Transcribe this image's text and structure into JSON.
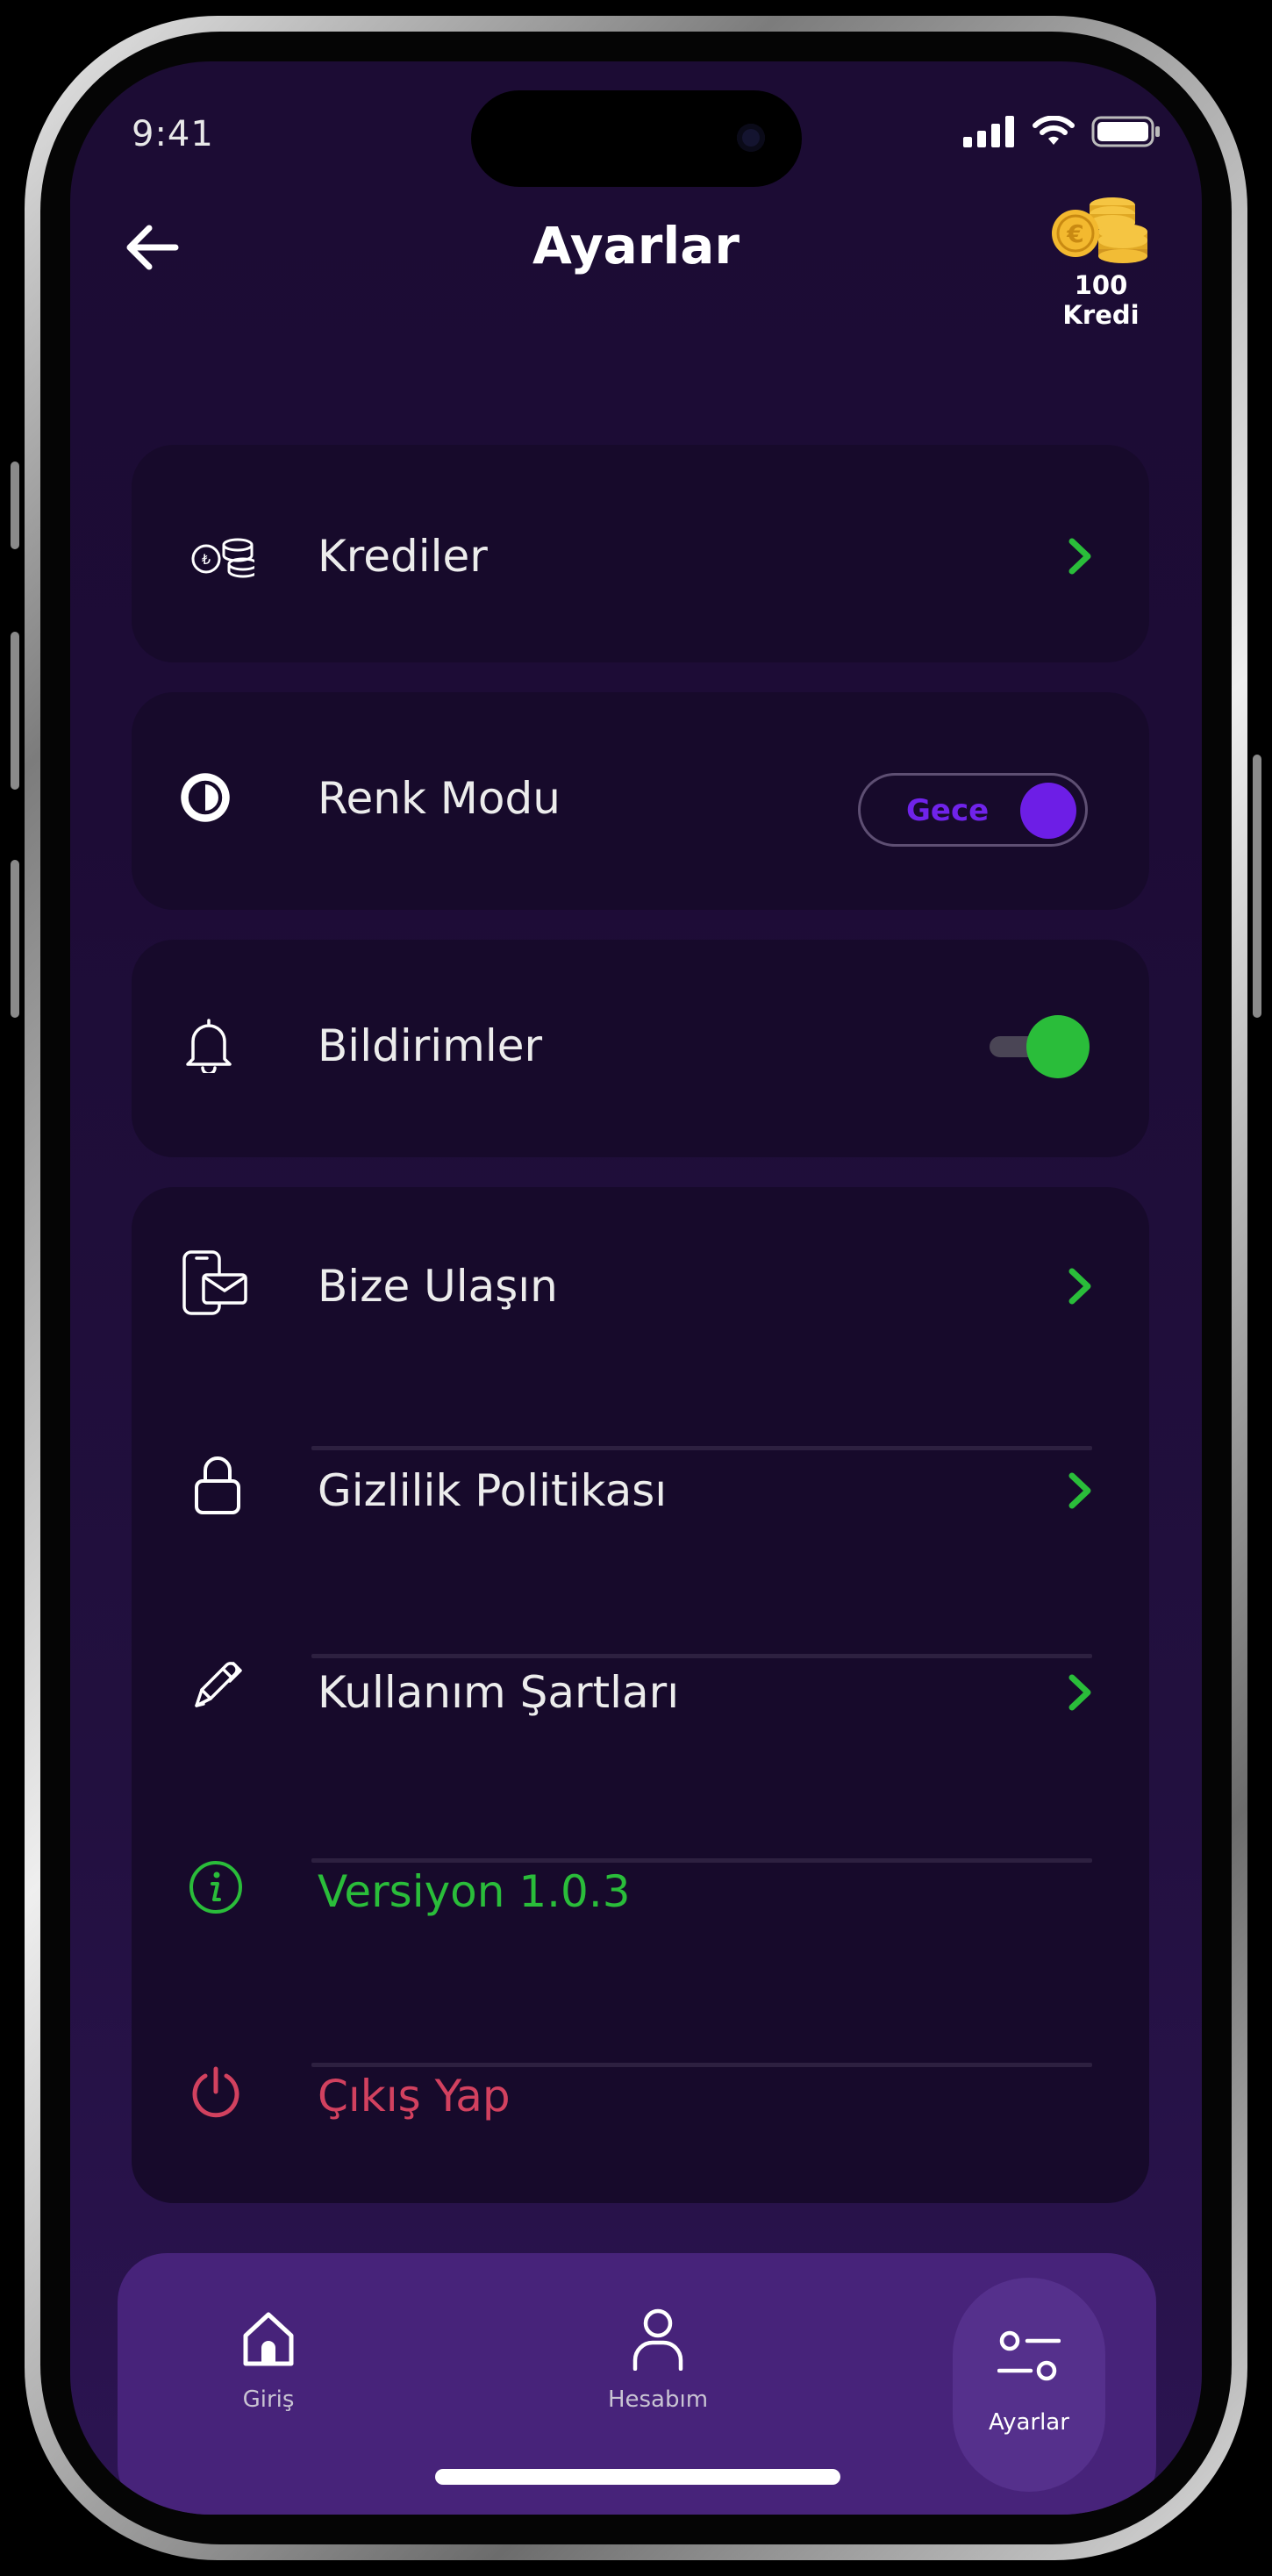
{
  "status_bar": {
    "time": "9:41"
  },
  "header": {
    "title": "Ayarlar",
    "credits_label": "100 Kredi"
  },
  "settings": {
    "credits": {
      "label": "Krediler"
    },
    "color_mode": {
      "label": "Renk Modu",
      "value": "Gece"
    },
    "notifications": {
      "label": "Bildirimler",
      "enabled": true
    },
    "links": [
      {
        "label": "Bize Ulaşın"
      },
      {
        "label": "Gizlilik Politikası"
      },
      {
        "label": "Kullanım Şartları"
      }
    ],
    "version": {
      "label": "Versiyon 1.0.3"
    },
    "logout": {
      "label": "Çıkış Yap"
    }
  },
  "tab_bar": {
    "items": [
      {
        "label": "Giriş",
        "icon": "home-icon",
        "active": false
      },
      {
        "label": "Hesabım",
        "icon": "user-icon",
        "active": false
      },
      {
        "label": "Ayarlar",
        "icon": "sliders-icon",
        "active": true
      }
    ]
  },
  "colors": {
    "background": "#1d0c36",
    "card": "#170a2b",
    "accent_green": "#2abd3a",
    "accent_purple": "#6d1ee6",
    "danger": "#d2415f",
    "tab_bar": "#47237a"
  }
}
